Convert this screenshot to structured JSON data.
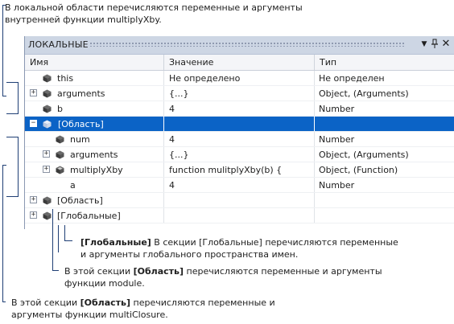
{
  "callouts": {
    "top": "В локальной области перечисляются переменные и аргументы\nвнутренней функции multiplyXby.",
    "global_bold": "[Глобальные]",
    "global_rest_line1": " В секции [Глобальные] перечисляются переменные",
    "global_line2": "и аргументы глобального пространства имен.",
    "scope1_pre": "В этой секции ",
    "scope1_bold": "[Область]",
    "scope1_rest": " перечисляются переменные и аргументы",
    "scope1_line2": "функции module.",
    "scope2_pre": "В этой секции ",
    "scope2_bold": "[Область]",
    "scope2_rest": " перечисляются переменные и",
    "scope2_line2": "аргументы функции multiClosure."
  },
  "window": {
    "title": "ЛОКАЛЬНЫЕ",
    "icons": [
      "dropdown-arrow-icon",
      "pin-icon",
      "close-icon"
    ]
  },
  "columns": {
    "name": "Имя",
    "value": "Значение",
    "type": "Тип"
  },
  "rows": [
    {
      "name": "this",
      "value": "Не определено",
      "type": "Не определен",
      "indent": 0,
      "expander": "",
      "icon": "cube-icon"
    },
    {
      "name": "arguments",
      "value": "{...}",
      "type": "Object, (Arguments)",
      "indent": 0,
      "expander": "+",
      "icon": "cube-icon"
    },
    {
      "name": "b",
      "value": "4",
      "type": "Number",
      "indent": 0,
      "expander": "",
      "icon": "cube-icon"
    },
    {
      "name": "[Область]",
      "value": "",
      "type": "",
      "indent": 0,
      "expander": "−",
      "icon": "cube-icon",
      "selected": true
    },
    {
      "name": "num",
      "value": "4",
      "type": "Number",
      "indent": 1,
      "expander": "",
      "icon": "cube-icon"
    },
    {
      "name": "arguments",
      "value": "{...}",
      "type": "Object, (Arguments)",
      "indent": 1,
      "expander": "+",
      "icon": "cube-icon"
    },
    {
      "name": "multiplyXby",
      "value": "function mulitplyXby(b) {",
      "type": "Object, (Function)",
      "indent": 1,
      "expander": "+",
      "icon": "method-cube-icon"
    },
    {
      "name": "a",
      "value": "4",
      "type": "Number",
      "indent": 1,
      "expander": "",
      "icon": ""
    },
    {
      "name": "[Область]",
      "value": "",
      "type": "",
      "indent": 0,
      "expander": "+",
      "icon": "cube-icon"
    },
    {
      "name": "[Глобальные]",
      "value": "",
      "type": "",
      "indent": 0,
      "expander": "+",
      "icon": "cube-icon"
    }
  ],
  "colors": {
    "selection": "#0b63c6",
    "titlebar": "#cdd6e4",
    "bracket": "#1f3f75"
  }
}
